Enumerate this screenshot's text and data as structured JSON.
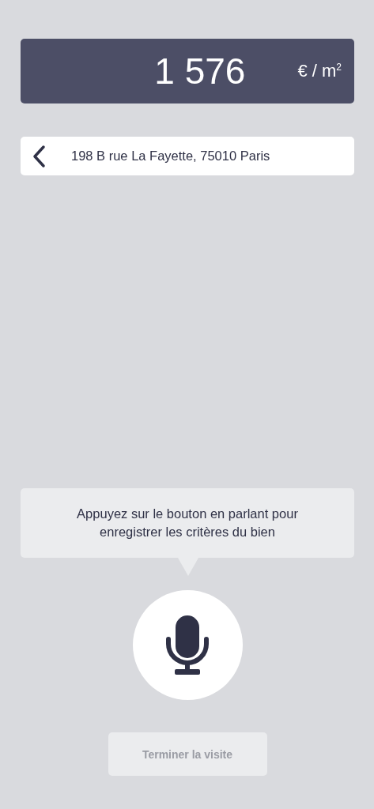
{
  "price": {
    "value": "1 576",
    "unit": "€ / m$^{2}$"
  },
  "address": {
    "text": "198 B rue La Fayette, 75010 Paris"
  },
  "hint": {
    "text": "Appuyez sur le bouton en parlant pour enregistrer les critères du bien"
  },
  "finish_button": {
    "label": "Terminer la visite",
    "disabled": true
  }
}
